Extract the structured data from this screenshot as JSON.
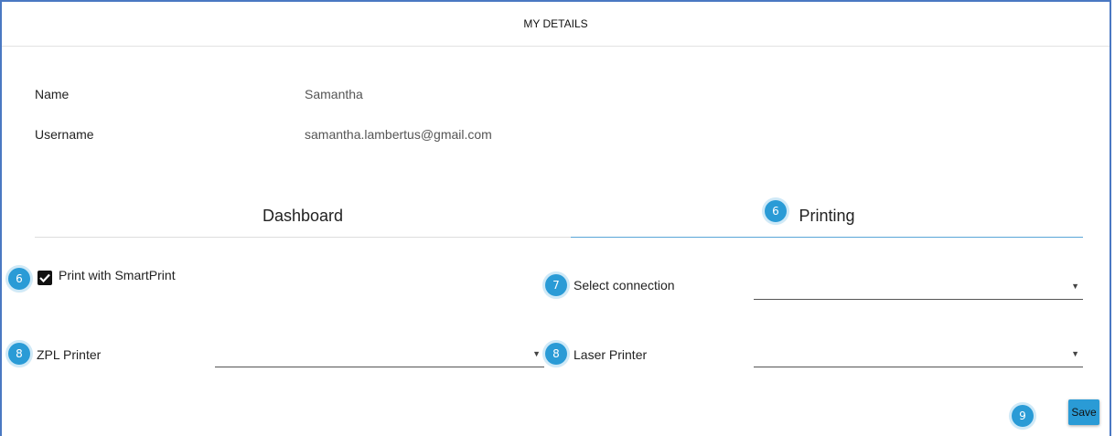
{
  "header": {
    "title": "MY DETAILS"
  },
  "profile": {
    "name_label": "Name",
    "name_value": "Samantha",
    "username_label": "Username",
    "username_value": "samantha.lambertus@gmail.com"
  },
  "tabs": [
    {
      "label": "Dashboard",
      "active": false
    },
    {
      "label": "Printing",
      "active": true
    }
  ],
  "printing": {
    "smartprint_label": "Print with SmartPrint",
    "smartprint_checked": true,
    "connection_label": "Select connection",
    "connection_value": "",
    "zpl_label": "ZPL Printer",
    "zpl_value": "",
    "laser_label": "Laser Printer",
    "laser_value": "",
    "dropdown_glyph": "▼",
    "save_label": "Save"
  },
  "callouts": {
    "tab_printing": "6",
    "smartprint": "6",
    "connection": "7",
    "zpl": "8",
    "laser": "8",
    "save": "9"
  },
  "colors": {
    "frame_border": "#4a78c2",
    "accent": "#2a9bd6",
    "active_tab_underline": "#5aa6d8",
    "inactive_tab_underline": "#dddddd"
  }
}
